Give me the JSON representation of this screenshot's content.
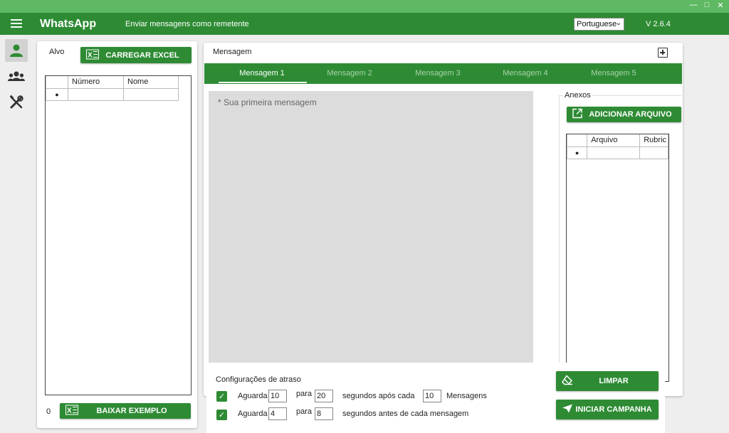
{
  "window": {
    "controls": [
      "minimize",
      "maximize",
      "close"
    ]
  },
  "appbar": {
    "title": "WhatsApp",
    "subtitle": "Enviar mensagens como remetente",
    "language": "Portuguese",
    "version": "V 2.6.4"
  },
  "nav": {
    "items": [
      "contact-icon",
      "group-icon",
      "tools-icon"
    ],
    "active": "contact-icon"
  },
  "target": {
    "label": "Alvo",
    "load_button": "CARREGAR EXCEL",
    "columns": [
      "Número",
      "Nome"
    ],
    "count": "0",
    "download_button": "BAIXAR EXEMPLO"
  },
  "message": {
    "header": "Mensagem",
    "tabs": [
      "Mensagem 1",
      "Mensagem 2",
      "Mensagem 3",
      "Mensagem 4",
      "Mensagem 5"
    ],
    "active_tab": "Mensagem 1",
    "placeholder": "* Sua primeira mensagem"
  },
  "attachments": {
    "legend": "Anexos",
    "add_button": "ADICIONAR ARQUIVO",
    "columns": [
      "Arquivo",
      "Rubric"
    ]
  },
  "delay": {
    "title": "Configurações de atraso",
    "row1": {
      "checked": true,
      "wait_label": "Aguarda",
      "from": "10",
      "to_label": "para",
      "to": "20",
      "after_label": "segundos após cada",
      "count": "10",
      "count_label": "Mensagens"
    },
    "row2": {
      "checked": true,
      "wait_label": "Aguarda",
      "from": "4",
      "to_label": "para",
      "to": "8",
      "after_label": "segundos antes de cada mensagem"
    }
  },
  "actions": {
    "clear_button": "LIMPAR",
    "start_button": "INICIAR CAMPANHA"
  },
  "colors": {
    "primary": "#2e8b34",
    "titlebar": "#5fb862"
  }
}
